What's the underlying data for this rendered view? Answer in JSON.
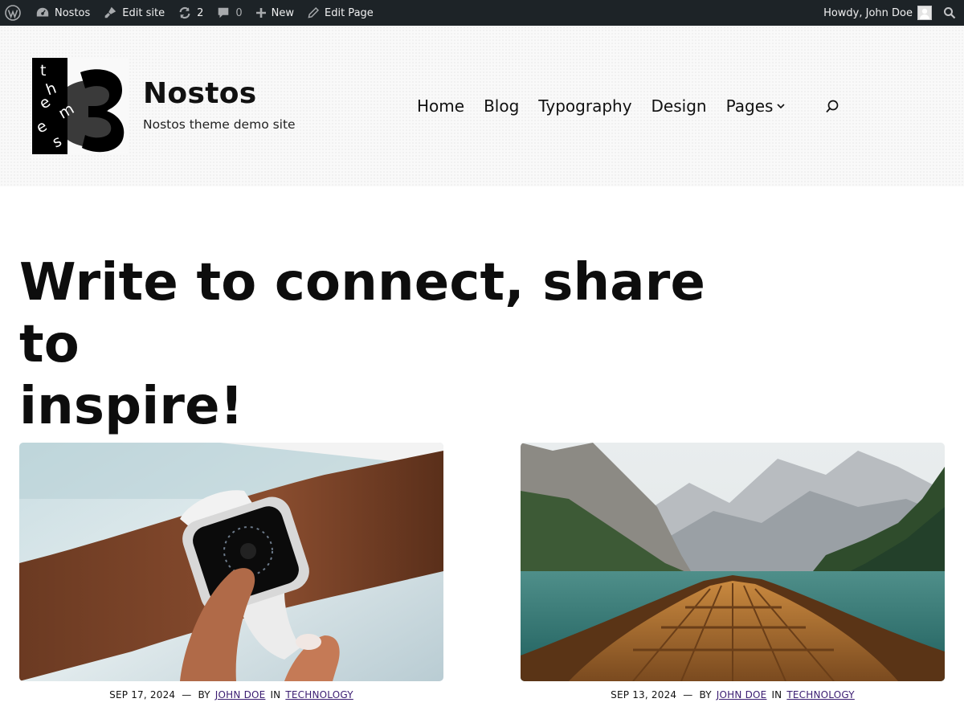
{
  "admin_bar": {
    "site_name": "Nostos",
    "edit_site": "Edit site",
    "updates_count": "2",
    "comments_count": "0",
    "new_label": "New",
    "edit_page": "Edit Page",
    "greeting": "Howdy, John Doe"
  },
  "header": {
    "logo_letters": [
      "t",
      "h",
      "e",
      "m",
      "e",
      "s",
      "3"
    ],
    "site_title": "Nostos",
    "tagline": "Nostos theme demo site",
    "nav": [
      {
        "label": "Home"
      },
      {
        "label": "Blog"
      },
      {
        "label": "Typography"
      },
      {
        "label": "Design"
      },
      {
        "label": "Pages",
        "has_submenu": true
      }
    ]
  },
  "hero": {
    "line1": "Write to connect, share to",
    "line2": "inspire!"
  },
  "posts": [
    {
      "date": "SEP 17, 2024",
      "by": "BY",
      "author": "JOHN DOE",
      "in": "IN",
      "category": "TECHNOLOGY",
      "image": "smartwatch-on-wrist"
    },
    {
      "date": "SEP 13, 2024",
      "by": "BY",
      "author": "JOHN DOE",
      "in": "IN",
      "category": "TECHNOLOGY",
      "image": "boat-on-mountain-lake"
    }
  ],
  "colors": {
    "admin_bar_bg": "#1d2327",
    "link": "#3b1d72",
    "text": "#111111"
  }
}
